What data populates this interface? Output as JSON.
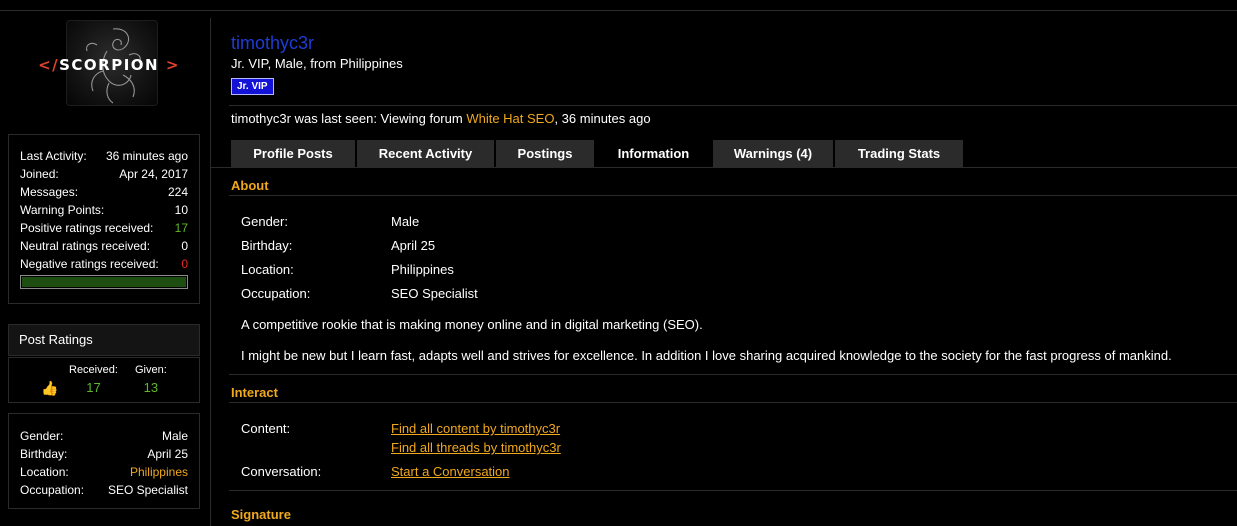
{
  "sidebar": {
    "logo_text": "SCORPION",
    "logo_open": "</",
    "logo_close": ">",
    "stats": [
      {
        "label": "Last Activity:",
        "value": "36 minutes ago"
      },
      {
        "label": "Joined:",
        "value": "Apr 24, 2017"
      },
      {
        "label": "Messages:",
        "value": "224"
      },
      {
        "label": "Warning Points:",
        "value": "10"
      },
      {
        "label": "Positive ratings received:",
        "value": "17"
      },
      {
        "label": "Neutral ratings received:",
        "value": "0"
      },
      {
        "label": "Negative ratings received:",
        "value": "0"
      }
    ],
    "rating_bar_fill": 1.0,
    "post_ratings": {
      "title": "Post Ratings",
      "received_label": "Received:",
      "received_value": "17",
      "given_label": "Given:",
      "given_value": "13",
      "icon": "thumbs-up-icon"
    },
    "info": [
      {
        "label": "Gender:",
        "value": "Male"
      },
      {
        "label": "Birthday:",
        "value": "April 25"
      },
      {
        "label": "Location:",
        "value": "Philippines"
      },
      {
        "label": "Occupation:",
        "value": "SEO Specialist"
      }
    ]
  },
  "profile": {
    "username": "timothyc3r",
    "title_line": "Jr. VIP, Male, from Philippines",
    "badge": "Jr. VIP",
    "last_seen_prefix": "timothyc3r was last seen: Viewing forum ",
    "last_seen_forum": "White Hat SEO",
    "last_seen_suffix": ", 36 minutes ago"
  },
  "tabs": [
    {
      "label": "Profile Posts"
    },
    {
      "label": "Recent Activity"
    },
    {
      "label": "Postings"
    },
    {
      "label": "Information",
      "active": true
    },
    {
      "label": "Warnings (4)"
    },
    {
      "label": "Trading Stats"
    }
  ],
  "about": {
    "heading": "About",
    "fields": [
      {
        "label": "Gender:",
        "value": "Male"
      },
      {
        "label": "Birthday:",
        "value": "April 25"
      },
      {
        "label": "Location:",
        "value": "Philippines"
      },
      {
        "label": "Occupation:",
        "value": "SEO Specialist"
      }
    ],
    "bio_1": "A competitive rookie that is making money online and in digital marketing (SEO).",
    "bio_2": "I might be new but I learn fast, adapts well and strives for excellence. In addition I love sharing acquired knowledge to the society for the fast progress of mankind."
  },
  "interact": {
    "heading": "Interact",
    "content_label": "Content:",
    "find_content": "Find all content by timothyc3r",
    "find_threads": "Find all threads by timothyc3r",
    "conversation_label": "Conversation:",
    "start_conversation": "Start a Conversation"
  },
  "signature": {
    "heading": "Signature"
  },
  "colors": {
    "accent": "#f0a81d",
    "username": "#1d3cd8",
    "positive": "#5eb82b",
    "negative": "#e82a2a",
    "badge": "#1313d8"
  }
}
